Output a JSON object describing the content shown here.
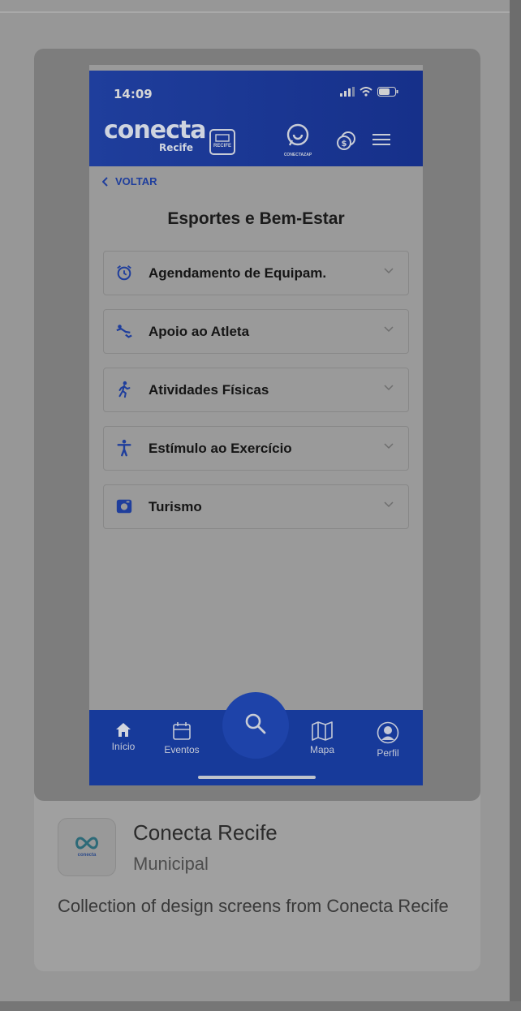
{
  "status_bar": {
    "time": "14:09"
  },
  "header": {
    "brand": "conecta",
    "brand_sub": "Recife",
    "crest_label": "RECIFE",
    "zap_label": "CONECTAZAP"
  },
  "nav": {
    "back_label": "VOLTAR"
  },
  "page": {
    "title": "Esportes e Bem-Estar"
  },
  "accordion": [
    {
      "label": "Agendamento de Equipam.",
      "icon": "alarm-clock-icon"
    },
    {
      "label": "Apoio ao Atleta",
      "icon": "athlete-support-icon"
    },
    {
      "label": "Atividades Físicas",
      "icon": "running-icon"
    },
    {
      "label": "Estímulo ao Exercício",
      "icon": "person-icon"
    },
    {
      "label": "Turismo",
      "icon": "camera-icon"
    }
  ],
  "tabbar": {
    "inicio": "Início",
    "eventos": "Eventos",
    "mapa": "Mapa",
    "perfil": "Perfil"
  },
  "app": {
    "name": "Conecta Recife",
    "category": "Municipal",
    "description": "Collection of design screens from Conecta Recife",
    "icon_text": "conecta"
  },
  "colors": {
    "brand_blue": "#1f3e9c",
    "tab_blue": "#173a9a"
  }
}
